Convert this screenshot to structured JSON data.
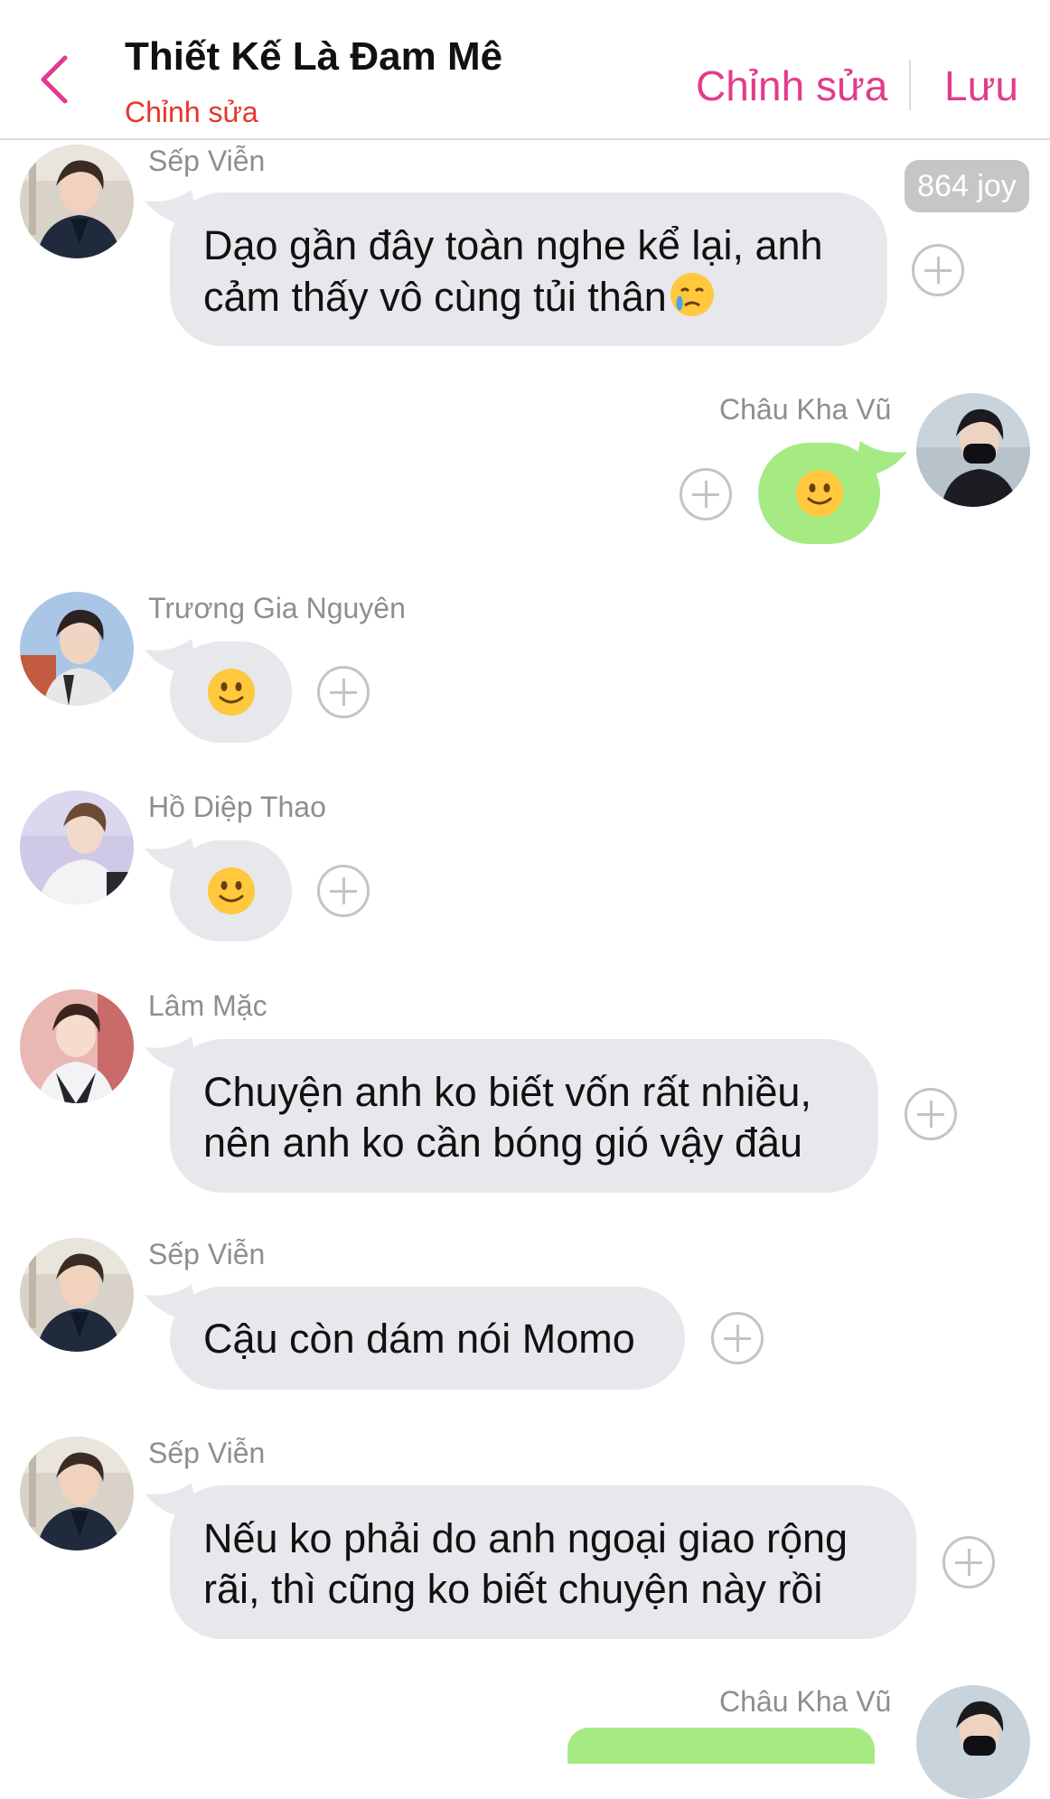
{
  "header": {
    "title": "Thiết Kế Là Đam Mê",
    "subtitle": "Chỉnh sửa",
    "edit_label": "Chỉnh sửa",
    "save_label": "Lưu",
    "back_icon": "chevron-left-icon",
    "accent_color": "#e33b8c"
  },
  "joy_badge": "864 joy",
  "messages": [
    {
      "sender": "Sếp Viễn",
      "side": "left",
      "lines": [
        "Dạo gần đây toàn nghe kể lại, anh",
        "cảm thấy vô cùng tủi thân"
      ],
      "trailing_emoji": "crying-face"
    },
    {
      "sender": "Châu Kha Vũ",
      "side": "right",
      "emoji": "slightly-smiling-face"
    },
    {
      "sender": "Trương Gia Nguyên",
      "side": "left",
      "emoji": "slightly-smiling-face"
    },
    {
      "sender": "Hồ Diệp Thao",
      "side": "left",
      "emoji": "slightly-smiling-face"
    },
    {
      "sender": "Lâm Mặc",
      "side": "left",
      "lines": [
        "Chuyện anh ko biết vốn rất nhiều,",
        "nên anh ko cần bóng gió vậy đâu"
      ]
    },
    {
      "sender": "Sếp Viễn",
      "side": "left",
      "lines": [
        "Cậu còn dám nói Momo"
      ]
    },
    {
      "sender": "Sếp Viễn",
      "side": "left",
      "lines": [
        "Nếu ko phải do anh ngoại giao rộng",
        "rãi, thì cũng ko biết chuyện này rồi"
      ]
    },
    {
      "sender": "Châu Kha Vũ",
      "side": "right"
    }
  ],
  "colors": {
    "incoming_bubble": "#e6e8eb",
    "outgoing_bubble": "#a6ea84",
    "subtitle": "#e8352e"
  }
}
